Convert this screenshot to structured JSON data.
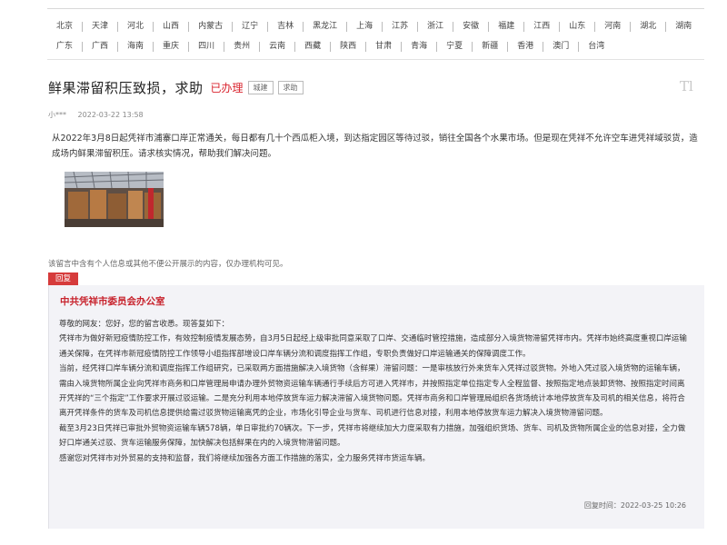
{
  "regions": {
    "row1": [
      "北京",
      "天津",
      "河北",
      "山西",
      "内蒙古",
      "辽宁",
      "吉林",
      "黑龙江",
      "上海",
      "江苏",
      "浙江",
      "安徽",
      "福建",
      "江西",
      "山东",
      "河南",
      "湖北",
      "湖南"
    ],
    "row2": [
      "广东",
      "广西",
      "海南",
      "重庆",
      "四川",
      "贵州",
      "云南",
      "西藏",
      "陕西",
      "甘肃",
      "青海",
      "宁夏",
      "新疆",
      "香港",
      "澳门",
      "台湾"
    ]
  },
  "message": {
    "title": "鲜果滞留积压致损，求助",
    "status": "已办理",
    "tags": [
      "城建",
      "求助"
    ],
    "author": "小***",
    "time": "2022-03-22 13:58",
    "content": "从2022年3月8日起凭祥市浦寨口岸正常通关，每日都有几十个西瓜柜入境，到达指定园区等待过驳，销往全国各个水果市场。但是现在凭祥不允许空车进凭祥域驳货，造成场内鲜果滞留积压。请求核实情况，帮助我们解决问题。",
    "notice": "该留言中含有个人信息或其他不便公开展示的内容，仅办理机构可见。",
    "logo_text": "Tl"
  },
  "reply": {
    "label": "回复",
    "org": "中共凭祥市委员会办公室",
    "paragraphs": [
      "尊敬的网友：您好，您的留言收悉。现答复如下：",
      "凭祥市为做好新冠疫情防控工作，有效控制疫情发展态势，自3月5日起经上级审批同意采取了口岸、交通临时管控措施，造成部分入境货物滞留凭祥市内。凭祥市始终高度重视口岸运输通关保障，在凭祥市新冠疫情防控工作领导小组指挥部增设口岸车辆分流和调度指挥工作组，专职负责做好口岸运输通关的保障调度工作。",
      "当前，经凭祥口岸车辆分流和调度指挥工作组研究，已采取两方面措施解决入境货物（含鲜果）滞留问题：一是审核放行外来货车入凭祥过驳货物。外地入凭过驳入境货物的运输车辆，需由入境货物所属企业向凭祥市商务和口岸管理局申请办理外贸物资运输车辆通行手续后方可进入凭祥市，并按照指定单位指定专人全程监督、按照指定地点装卸货物、按照指定时间离开凭祥的“三个指定”工作要求开展过驳运输。二是充分利用本地停放货车运力解决滞留入境货物问题。凭祥市商务和口岸管理局组织各货场统计本地停放货车及司机的相关信息，将符合离开凭祥条件的货车及司机信息提供给需过驳货物运输离凭的企业，市场化引导企业与货车、司机进行信息对接，利用本地停放货车运力解决入境货物滞留问题。",
      "截至3月23日凭祥已审批外贸物资运输车辆578辆，单日审批约70辆次。下一步，凭祥市将继续加大力度采取有力措施，加强组织货场、货车、司机及货物所属企业的信息对接，全力做好口岸通关过驳、货车运输服务保障，加快解决包括鲜果在内的入境货物滞留问题。",
      "感谢您对凭祥市对外贸易的支持和监督，我们将继续加强各方面工作措施的落实，全力服务凭祥市货运车辆。"
    ],
    "time": "回复时间：2022-03-25 10:26"
  }
}
